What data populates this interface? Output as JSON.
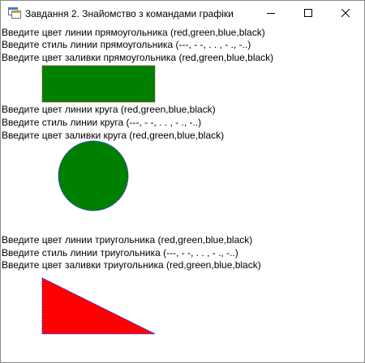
{
  "window": {
    "title": "Завдання 2. Знайомство з командами графіки",
    "icons": {
      "app": "app-window-icon",
      "minimize": "minimize-icon",
      "maximize": "maximize-icon",
      "close": "close-icon"
    }
  },
  "rectangle_section": {
    "line_color_label": "Введите цвет линии прямоугольника (red,green,blue,black)",
    "line_style_label": "Введите стиль линии прямоугольника (---, - -, . . , - ., -..)",
    "fill_color_label": "Введите цвет заливки прямоугольника (red,green,blue,black)",
    "fill_color": "#008000",
    "line_color": "#b22222"
  },
  "circle_section": {
    "line_color_label": "Введите цвет линии круга (red,green,blue,black)",
    "line_style_label": "Введите стиль линии круга (---, - -, . . , - ., -..)",
    "fill_color_label": "Введите цвет заливки круга (red,green,blue,black)",
    "fill_color": "#008000",
    "line_color": "#0000ff"
  },
  "triangle_section": {
    "line_color_label": "Введите цвет линии триугольника (red,green,blue,black)",
    "line_style_label": "Введите стиль линии триугольника (---, - -, . . , - ., -..)",
    "fill_color_label": "Введите цвет заливки триугольника (red,green,blue,black)",
    "fill_color": "#ff0000",
    "line_color": "#0000ff"
  }
}
